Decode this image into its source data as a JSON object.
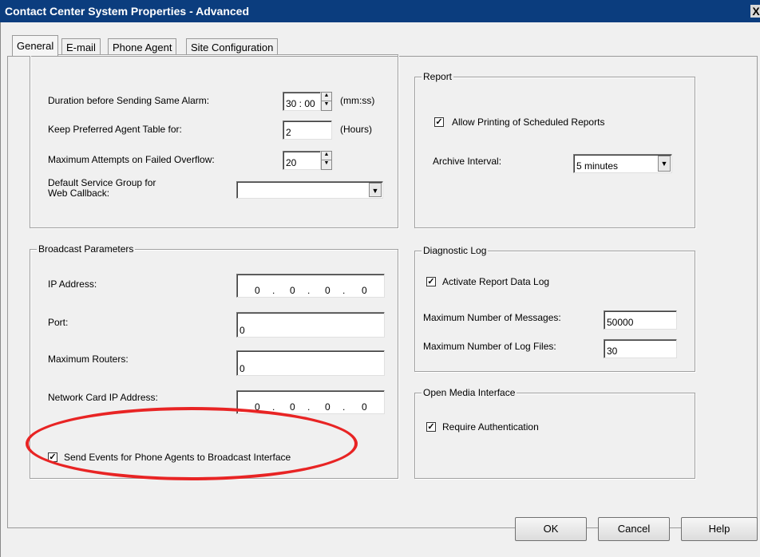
{
  "window": {
    "title": "Contact Center System Properties - Advanced",
    "close_glyph": "X"
  },
  "tabs": [
    {
      "label": "General",
      "active": true
    },
    {
      "label": "E-mail",
      "active": false
    },
    {
      "label": "Phone Agent",
      "active": false
    },
    {
      "label": "Site Configuration",
      "active": false
    }
  ],
  "alarm_group": {
    "duration_label": "Duration before Sending Same Alarm:",
    "duration_value": "30 : 00",
    "duration_unit": "(mm:ss)",
    "preferred_label": "Keep Preferred Agent Table for:",
    "preferred_value": "2",
    "preferred_unit": "(Hours)",
    "attempts_label": "Maximum Attempts on Failed Overflow:",
    "attempts_value": "20",
    "service_group_label_line1": "Default Service Group for",
    "service_group_label_line2": "Web Callback:",
    "service_group_value": ""
  },
  "broadcast": {
    "legend": "Broadcast Parameters",
    "ip_label": "IP Address:",
    "ip_segments": [
      "0",
      "0",
      "0",
      "0"
    ],
    "ip_dot": ".",
    "port_label": "Port:",
    "port_value": "0",
    "routers_label": "Maximum Routers:",
    "routers_value": "0",
    "nic_label": "Network Card IP Address:",
    "nic_segments": [
      "0",
      "0",
      "0",
      "0"
    ],
    "send_events_label": "Send Events for Phone Agents to Broadcast Interface",
    "send_events_checked": true
  },
  "report": {
    "legend": "Report",
    "allow_printing_label": "Allow Printing of Scheduled Reports",
    "allow_printing_checked": true,
    "archive_label": "Archive Interval:",
    "archive_value": "5 minutes"
  },
  "diagnostic": {
    "legend": "Diagnostic Log",
    "activate_label": "Activate Report Data Log",
    "activate_checked": true,
    "max_messages_label": "Maximum Number of Messages:",
    "max_messages_value": "50000",
    "max_files_label": "Maximum Number of Log Files:",
    "max_files_value": "30"
  },
  "open_media": {
    "legend": "Open Media Interface",
    "require_auth_label": "Require Authentication",
    "require_auth_checked": true
  },
  "buttons": {
    "ok": "OK",
    "cancel": "Cancel",
    "help": "Help"
  },
  "glyphs": {
    "check": "✓",
    "spin_up": "▲",
    "spin_down": "▼",
    "dropdown": "▼"
  },
  "colors": {
    "titlebar": "#0b3d7e",
    "annotation": "#e82424"
  }
}
